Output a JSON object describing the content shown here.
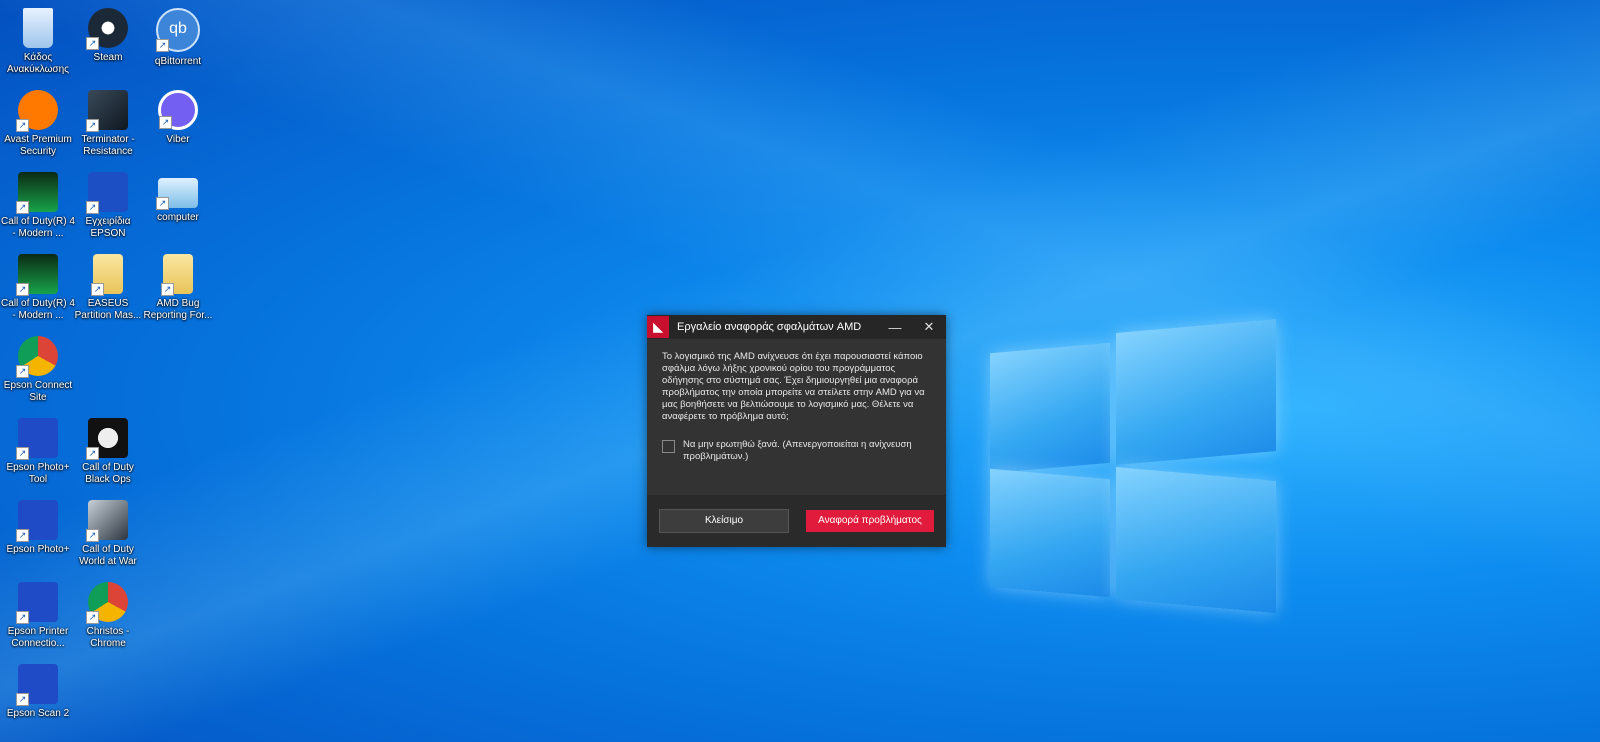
{
  "desktop": {
    "icons": [
      {
        "label": "Κάδος Ανακύκλωσης",
        "icon": "recycle-bin-icon"
      },
      {
        "label": "Steam",
        "icon": "steam-icon"
      },
      {
        "label": "qBittorrent",
        "icon": "qbittorrent-icon"
      },
      {
        "label": "Avast Premium Security",
        "icon": "avast-icon"
      },
      {
        "label": "Terminator - Resistance",
        "icon": "terminator-icon"
      },
      {
        "label": "Viber",
        "icon": "viber-icon"
      },
      {
        "label": "Call of Duty(R) 4 - Modern ...",
        "icon": "cod4-icon"
      },
      {
        "label": "Εγχειρίδια EPSON",
        "icon": "epson-manuals-icon"
      },
      {
        "label": "computer",
        "icon": "computer-icon"
      },
      {
        "label": "Call of Duty(R) 4 - Modern ...",
        "icon": "cod4-icon"
      },
      {
        "label": "EASEUS Partition Mas...",
        "icon": "folder-icon"
      },
      {
        "label": "AMD Bug Reporting For...",
        "icon": "folder-icon"
      },
      {
        "label": "Epson Connect Site",
        "icon": "chrome-icon"
      },
      {
        "label": "Epson Photo+ Tool",
        "icon": "epson-photo-tool-icon"
      },
      {
        "label": "Call of Duty Black Ops",
        "icon": "cod-black-ops-icon"
      },
      {
        "label": "Epson Photo+",
        "icon": "epson-photo-icon"
      },
      {
        "label": "Call of Duty World at War",
        "icon": "cod-waw-icon"
      },
      {
        "label": "Epson Printer Connectio...",
        "icon": "epson-printer-icon"
      },
      {
        "label": "Christos - Chrome",
        "icon": "chrome-icon"
      },
      {
        "label": "Epson Scan 2",
        "icon": "epson-scan-icon"
      }
    ]
  },
  "dialog": {
    "title": "Εργαλείο αναφοράς σφαλμάτων AMD",
    "message": "Το λογισμικό της AMD ανίχνευσε ότι έχει παρουσιαστεί κάποιο σφάλμα λόγω λήξης χρονικού ορίου του προγράμματος οδήγησης στο σύστημά σας. Έχει δημιουργηθεί μια αναφορά προβλήματος την οποία μπορείτε να στείλετε στην AMD για να μας βοηθήσετε να βελτιώσουμε το λογισμικό μας. Θέλετε να αναφέρετε το πρόβλημα αυτό;",
    "checkbox_label": "Να μην ερωτηθώ ξανά. (Απενεργοποιείται η ανίχνευση προβλημάτων.)",
    "close_label": "Κλείσιμο",
    "report_label": "Αναφορά προβλήματος",
    "minimize_glyph": "—",
    "close_glyph": "✕",
    "accent": "#e01b3c"
  }
}
